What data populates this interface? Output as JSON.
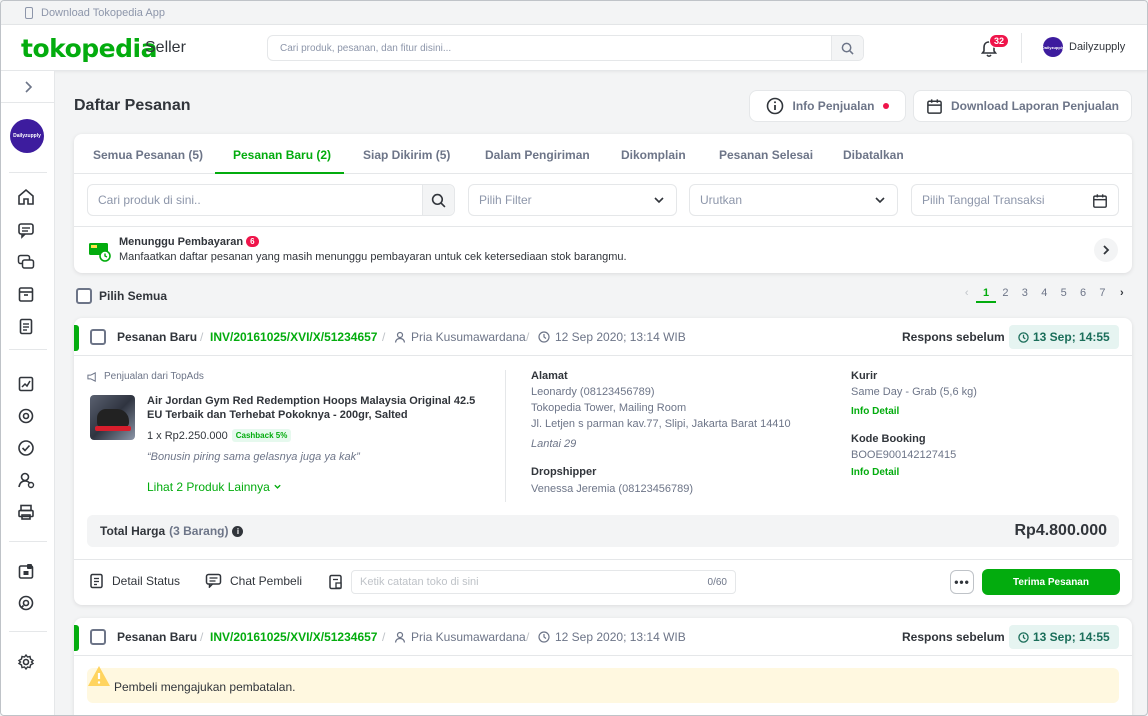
{
  "topstrip": {
    "label": "Download Tokopedia App"
  },
  "header": {
    "logo": "tokopedia",
    "logo_suffix": "Seller",
    "search_placeholder": "Cari produk, pesanan, dan fitur disini...",
    "notif_count": "32",
    "user_name": "Dailyzupply",
    "avatar_text": "Dailyzupply"
  },
  "sidebar": {
    "avatar_text": "Dailyzupply",
    "icons": [
      "home-icon",
      "chat-icon",
      "discussion-icon",
      "product-icon",
      "order-list-icon",
      "statistics-icon",
      "ads-icon",
      "ratings-icon",
      "member-icon",
      "shop-decoration-icon",
      "shop-icon",
      "support-icon",
      "settings-icon"
    ]
  },
  "page": {
    "title": "Daftar Pesanan",
    "info_btn": "Info Penjualan",
    "download_btn": "Download Laporan Penjualan"
  },
  "tabs": [
    "Semua Pesanan (5)",
    "Pesanan Baru (2)",
    "Siap Dikirim (5)",
    "Dalam Pengiriman",
    "Dikomplain",
    "Pesanan Selesai",
    "Dibatalkan"
  ],
  "filters": {
    "search_placeholder": "Cari produk di sini..",
    "filter": "Pilih Filter",
    "sort": "Urutkan",
    "date": "Pilih Tanggal Transaksi"
  },
  "banner": {
    "title": "Menunggu Pembayaran",
    "count": "6",
    "desc": "Manfaatkan daftar pesanan yang masih menunggu pembayaran untuk cek ketersediaan stok barangmu."
  },
  "list_controls": {
    "select_all": "Pilih Semua",
    "pages": [
      "1",
      "2",
      "3",
      "4",
      "5",
      "6",
      "7"
    ]
  },
  "orders": [
    {
      "status": "Pesanan Baru",
      "invoice": "INV/20161025/XVI/X/51234657",
      "buyer": "Pria Kusumawardana",
      "date": "12 Sep 2020; 13:14 WIB",
      "respond_label": "Respons sebelum",
      "deadline": "13 Sep; 14:55",
      "source": "Penjualan dari TopAds",
      "product_name_1": "Air Jordan Gym Red Redemption Hoops Malaysia Original 42.5",
      "product_name_2": "EU Terbaik dan Terhebat Pokoknya - 200gr, Salted",
      "qty_price": "1 x Rp2.250.000",
      "cashback": "Cashback 5%",
      "note": "“Bonusin piring sama gelasnya juga ya kak”",
      "more_products": "Lihat 2 Produk Lainnya",
      "address_label": "Alamat",
      "address_lines": [
        "Leonardy (08123456789)",
        "Tokopedia Tower, Mailing Room",
        "Jl. Letjen s parman kav.77, Slipi, Jakarta Barat 14410"
      ],
      "address_note": "Lantai 29",
      "dropshipper_label": "Dropshipper",
      "dropshipper": "Venessa Jeremia (08123456789)",
      "courier_label": "Kurir",
      "courier": "Same Day - Grab (5,6 kg)",
      "courier_link": "Info Detail",
      "booking_label": "Kode Booking",
      "booking": "BOOE900142127415",
      "booking_link": "Info Detail",
      "total_label": "Total Harga",
      "total_count": "(3 Barang)",
      "total_value": "Rp4.800.000",
      "detail_status": "Detail Status",
      "chat_buyer": "Chat Pembeli",
      "note_placeholder": "Ketik catatan toko di sini",
      "note_count": "0/60",
      "more_btn": "•••",
      "accept_btn": "Terima Pesanan"
    },
    {
      "status": "Pesanan Baru",
      "invoice": "INV/20161025/XVI/X/51234657",
      "buyer": "Pria Kusumawardana",
      "date": "12 Sep 2020; 13:14 WIB",
      "respond_label": "Respons sebelum",
      "deadline": "13 Sep; 14:55",
      "warning": "Pembeli mengajukan pembatalan."
    }
  ],
  "colors": {
    "brand": "#03ac0e",
    "badge": "#ef144a",
    "deadline_bg": "#e6f4f1",
    "warning_bg": "#fff8e0"
  }
}
